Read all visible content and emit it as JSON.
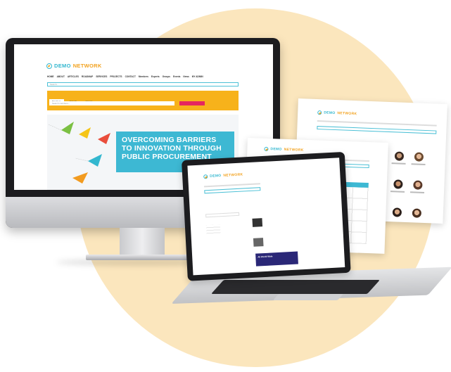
{
  "monitor_site": {
    "logo_word1": "DEMO",
    "logo_word2": "NETWORK",
    "nav": [
      "HOME",
      "ABOUT",
      "ARTICLES",
      "ROADMAP",
      "SERVICES",
      "PROJECTS",
      "CONTACT",
      "Members",
      "Experts",
      "Groups",
      "Events",
      "News",
      "MY ADMIN"
    ],
    "search_placeholder": "Search...",
    "tabs": [
      "Members",
      "Experts",
      "Groups"
    ],
    "members_search_placeholder": "Search members...",
    "hero_text": "OVERCOMING BARRIERS TO INNOVATION THROUGH PUBLIC PROCUREMENT",
    "colors": {
      "accent_blue": "#33b7cf",
      "accent_orange": "#f2a21f",
      "panel_orange": "#f7b21b",
      "button_red": "#e5265f",
      "hero_blue": "#3db8d3"
    }
  },
  "laptop_site": {
    "logo_word1": "DEMO",
    "logo_word2": "NETWORK",
    "promo_title": "All World Wide"
  },
  "calendar_site": {
    "logo_word1": "DEMO",
    "logo_word2": "NETWORK"
  },
  "members_site": {
    "logo_word1": "DEMO",
    "logo_word2": "NETWORK"
  },
  "icons": [
    "monitor-device",
    "laptop-device",
    "paper-plane-icon",
    "avatar-icon"
  ]
}
